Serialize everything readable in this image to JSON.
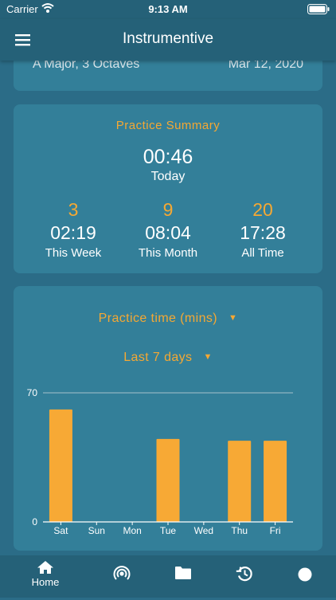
{
  "status_bar": {
    "carrier": "Carrier",
    "time": "9:13 AM",
    "wifi_icon": "wifi-icon",
    "battery_icon": "battery-icon"
  },
  "app_bar": {
    "title": "Instrumentive",
    "menu_icon": "hamburger-menu-icon"
  },
  "last_session": {
    "title": "A Major, 3 Octaves",
    "date": "Mar 12, 2020"
  },
  "summary": {
    "title": "Practice Summary",
    "today_time": "00:46",
    "today_label": "Today",
    "stats": [
      {
        "count": "3",
        "time": "02:19",
        "label": "This Week"
      },
      {
        "count": "9",
        "time": "08:04",
        "label": "This Month"
      },
      {
        "count": "20",
        "time": "17:28",
        "label": "All Time"
      }
    ]
  },
  "chart_controls": {
    "metric": "Practice time (mins)",
    "range": "Last 7 days"
  },
  "chart_data": {
    "type": "bar",
    "categories": [
      "Sat",
      "Sun",
      "Mon",
      "Tue",
      "Wed",
      "Thu",
      "Fri"
    ],
    "values": [
      61,
      0,
      0,
      45,
      0,
      44,
      44
    ],
    "ylim": [
      0,
      70
    ],
    "yticks": [
      0,
      70
    ],
    "bar_color": "#f7a935",
    "grid": true
  },
  "bottom_nav": {
    "home_label": "Home",
    "icons": [
      "home-icon",
      "broadcast-icon",
      "folder-icon",
      "history-icon",
      "record-icon"
    ]
  },
  "colors": {
    "background": "#2b6c87",
    "card": "#337f99",
    "bar": "#256178",
    "accent": "#f5a833"
  }
}
